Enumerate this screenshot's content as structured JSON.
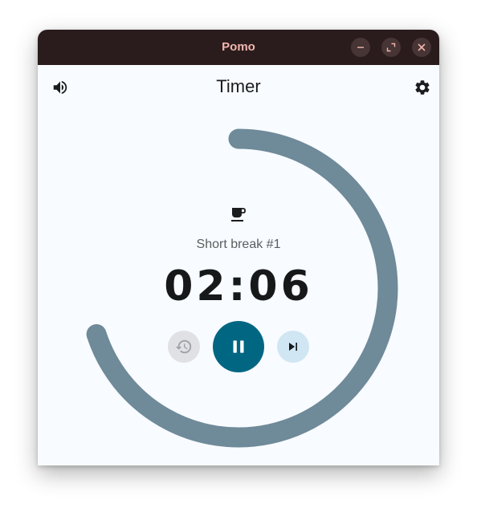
{
  "window": {
    "title": "Pomo",
    "controls": [
      "minimize",
      "maximize",
      "close"
    ]
  },
  "appbar": {
    "title": "Timer",
    "left_icon": "volume-icon",
    "right_icon": "gear-icon"
  },
  "timer": {
    "session_icon": "coffee-icon",
    "session_label": "Short break #1",
    "time": "02:06",
    "progress_remaining_fraction": 0.7,
    "ring_color": "#6f8a99",
    "ring_track": "none"
  },
  "controls": {
    "reset": {
      "icon": "history-icon",
      "enabled": false
    },
    "pause": {
      "icon": "pause-icon",
      "color": "#006682"
    },
    "skip": {
      "icon": "skip-next-icon",
      "color": "#d0e6f3"
    }
  },
  "colors": {
    "titlebar_bg": "#2a1c1c",
    "title_text": "#f1b5ad",
    "window_bg": "#f8fbff"
  }
}
